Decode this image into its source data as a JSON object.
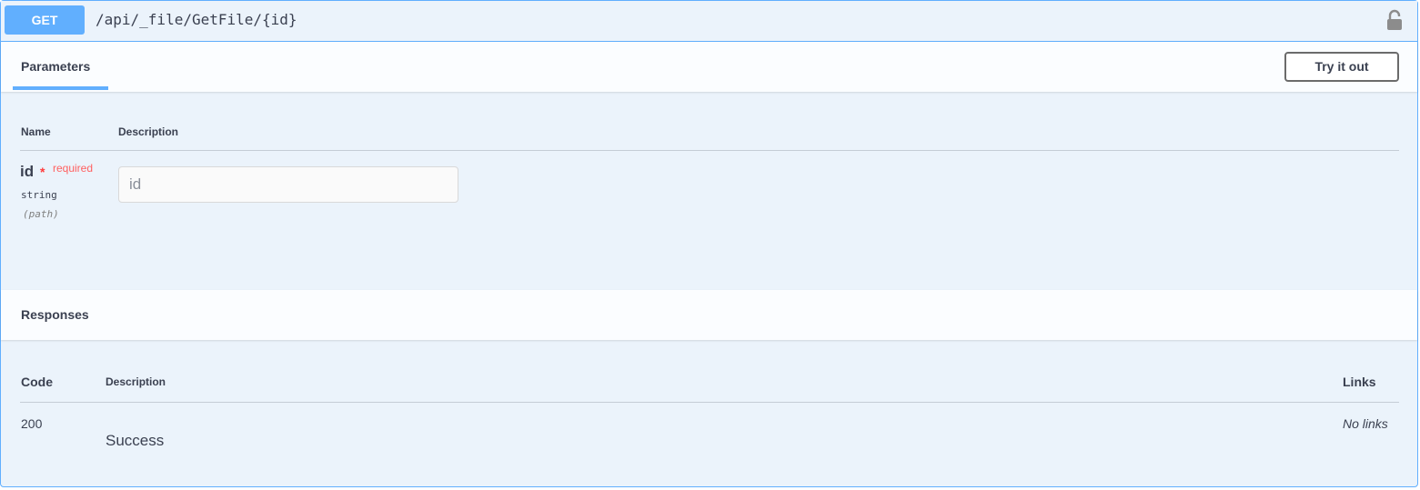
{
  "operation": {
    "method": "GET",
    "path": "/api/_file/GetFile/{id}",
    "lock_icon": "lock-icon"
  },
  "parameters": {
    "tab_label": "Parameters",
    "try_button_label": "Try it out",
    "columns": {
      "name": "Name",
      "description": "Description"
    },
    "items": [
      {
        "name": "id",
        "asterisk": "*",
        "required_label": "required",
        "type": "string",
        "in": "(path)",
        "placeholder": "id",
        "value": ""
      }
    ]
  },
  "responses": {
    "tab_label": "Responses",
    "columns": {
      "code": "Code",
      "description": "Description",
      "links": "Links"
    },
    "rows": [
      {
        "code": "200",
        "description": "Success",
        "links": "No links"
      }
    ]
  },
  "colors": {
    "get_accent": "#61affe",
    "block_background": "#ebf3fb",
    "required_red": "#ff6060"
  }
}
